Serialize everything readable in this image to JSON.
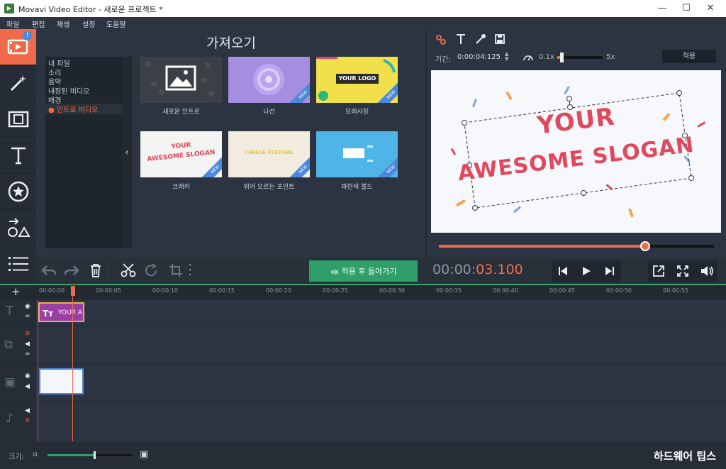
{
  "window": {
    "title": "Movavi Video Editor - 새로운 프로젝트 *",
    "minimize": "—",
    "maximize": "☐",
    "close": "✕"
  },
  "menu": [
    "파일",
    "편집",
    "재생",
    "설정",
    "도움말"
  ],
  "import": {
    "title": "가져오기",
    "tree": [
      "내 파일",
      "소리",
      "음악",
      "내장된 비디오",
      "배경",
      "인트로 비디오"
    ],
    "selected_tree": "인트로 비디오",
    "collapse_glyph": "‹",
    "notification_badge": "!",
    "items": [
      {
        "label": "새로운 인트로"
      },
      {
        "label": "나선",
        "new": "NEW"
      },
      {
        "label": "모래사장",
        "new": "NEW",
        "thumb_text": "YOUR LOGO"
      },
      {
        "label": "크래커",
        "new": "NEW",
        "thumb_text_1": "YOUR",
        "thumb_text_2": "AWESOME SLOGAN"
      },
      {
        "label": "튀어 오르는 포인트",
        "new": "NEW",
        "thumb_text": "CHEESE FESTIVAL"
      },
      {
        "label": "파란색 볼드",
        "new": "NEW"
      }
    ]
  },
  "properties": {
    "duration_label": "기간:",
    "duration_value": "0:00:04:125",
    "speed_min": "0.1x",
    "speed_max": "5x",
    "speed_level": 0.1,
    "apply_label": "적용"
  },
  "preview": {
    "line1": "YOUR",
    "line2": "AWESOME SLOGAN",
    "progress": 0.75
  },
  "toolbar": {
    "apply_back_label": "적용 후 돌아가기",
    "time_prefix": "00:00:",
    "time_suffix": "03.100"
  },
  "ruler": [
    "00:00:00",
    "00:00:05",
    "00:00:10",
    "00:00:15",
    "00:00:20",
    "00:00:25",
    "00:00:30",
    "00:00:35",
    "00:00:40",
    "00:00:45",
    "00:00:50",
    "00:00:55"
  ],
  "tracks": {
    "title_clip_text": "YOUR A",
    "add_glyph": "+"
  },
  "bottom": {
    "size_label": "크기:",
    "zoom_level": 0.55
  },
  "watermark": "하드웨어 팁스",
  "colors": {
    "accent": "#ef6a4a",
    "green": "#2f9e6a",
    "slogan": "#e0485e"
  }
}
